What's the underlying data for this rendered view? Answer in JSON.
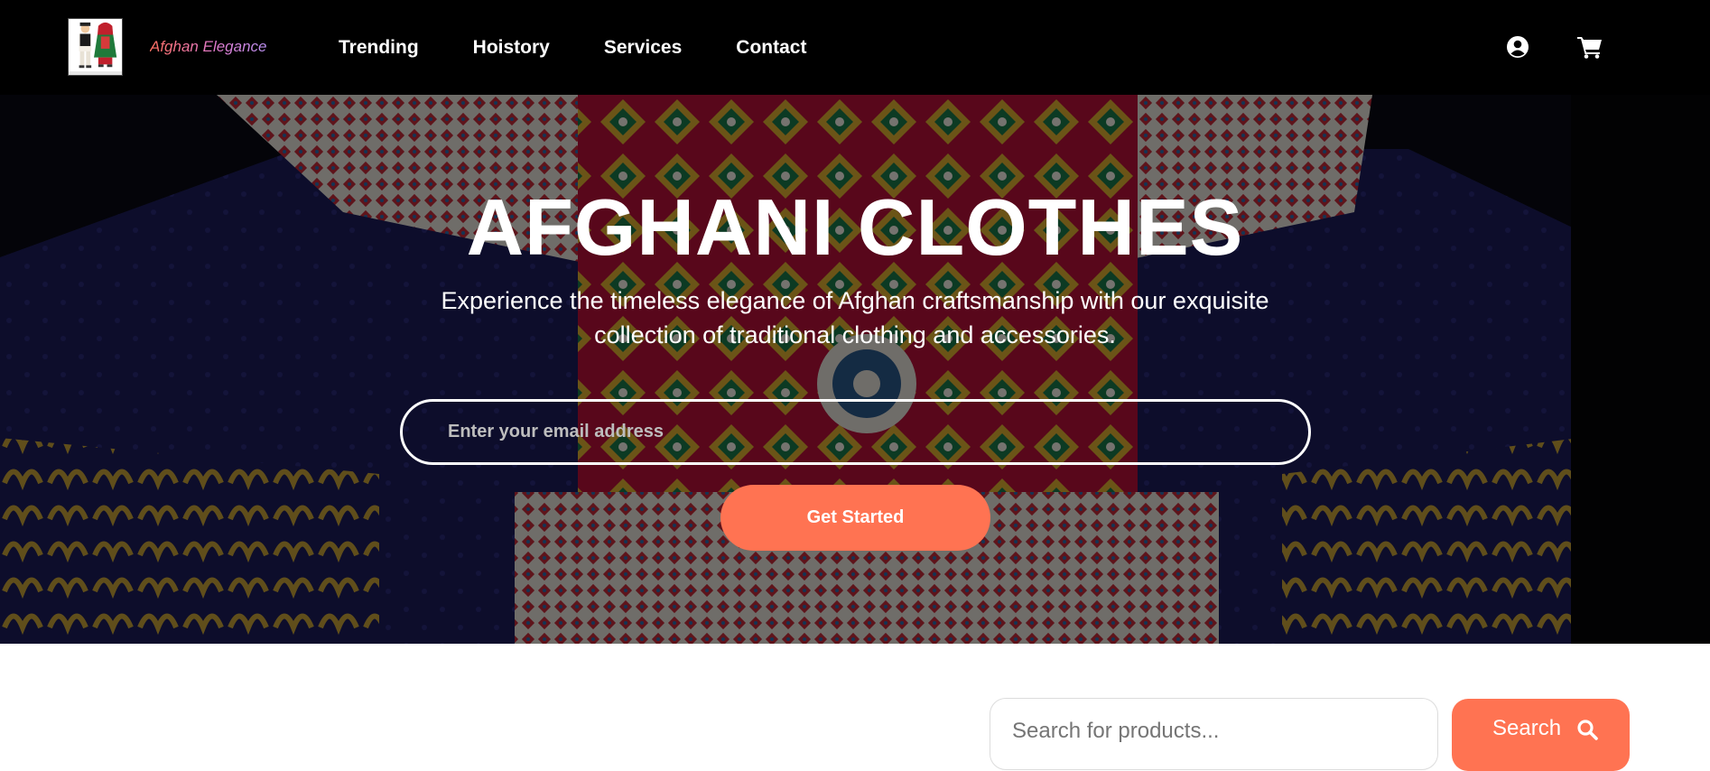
{
  "navbar": {
    "brand": "Afghan Elegance",
    "links": [
      "Trending",
      "Hoistory",
      "Services",
      "Contact"
    ],
    "icons": [
      "user-circle-icon",
      "shopping-cart-icon"
    ]
  },
  "hero": {
    "title": "AFGHANI CLOTHES",
    "subtitle": "Experience the timeless elegance of Afghan craftsmanship with our exquisite collection of traditional clothing and accessories.",
    "email_placeholder": "Enter your email address",
    "cta_label": "Get Started"
  },
  "search": {
    "placeholder": "Search for products...",
    "button_label": "Search",
    "button_icon": "search-icon"
  },
  "colors": {
    "navbar_bg": "#000000",
    "accent": "#ff7352",
    "brand_gradient_start": "#ff6f61",
    "brand_gradient_end": "#b98ff0"
  }
}
